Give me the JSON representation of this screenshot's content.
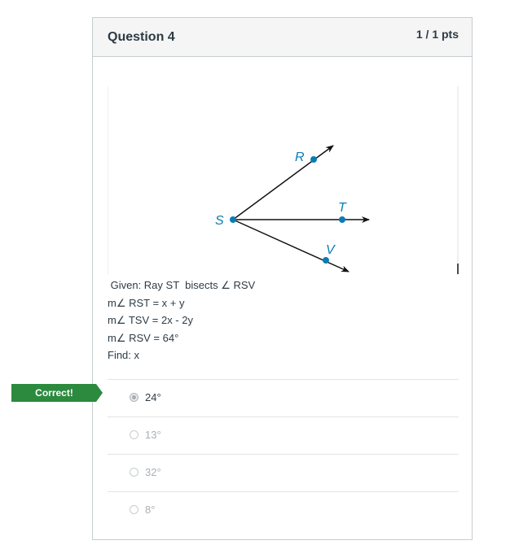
{
  "question": {
    "title": "Question 4",
    "points": "1 / 1 pts"
  },
  "figure": {
    "labels": {
      "r": "R",
      "t": "T",
      "s": "S",
      "v": "V"
    },
    "accent_color": "#0a7cb5"
  },
  "prompt_lines": [
    " Given: Ray ST  bisects ∠ RSV",
    "m∠ RST = x + y",
    "m∠ TSV = 2x - 2y",
    "m∠ RSV = 64°",
    "Find: x"
  ],
  "answers": [
    {
      "label": "24°",
      "selected": true
    },
    {
      "label": "13°",
      "selected": false
    },
    {
      "label": "32°",
      "selected": false
    },
    {
      "label": "8°",
      "selected": false
    }
  ],
  "result_flag": {
    "text": "Correct!",
    "color": "#2b8a3e"
  }
}
